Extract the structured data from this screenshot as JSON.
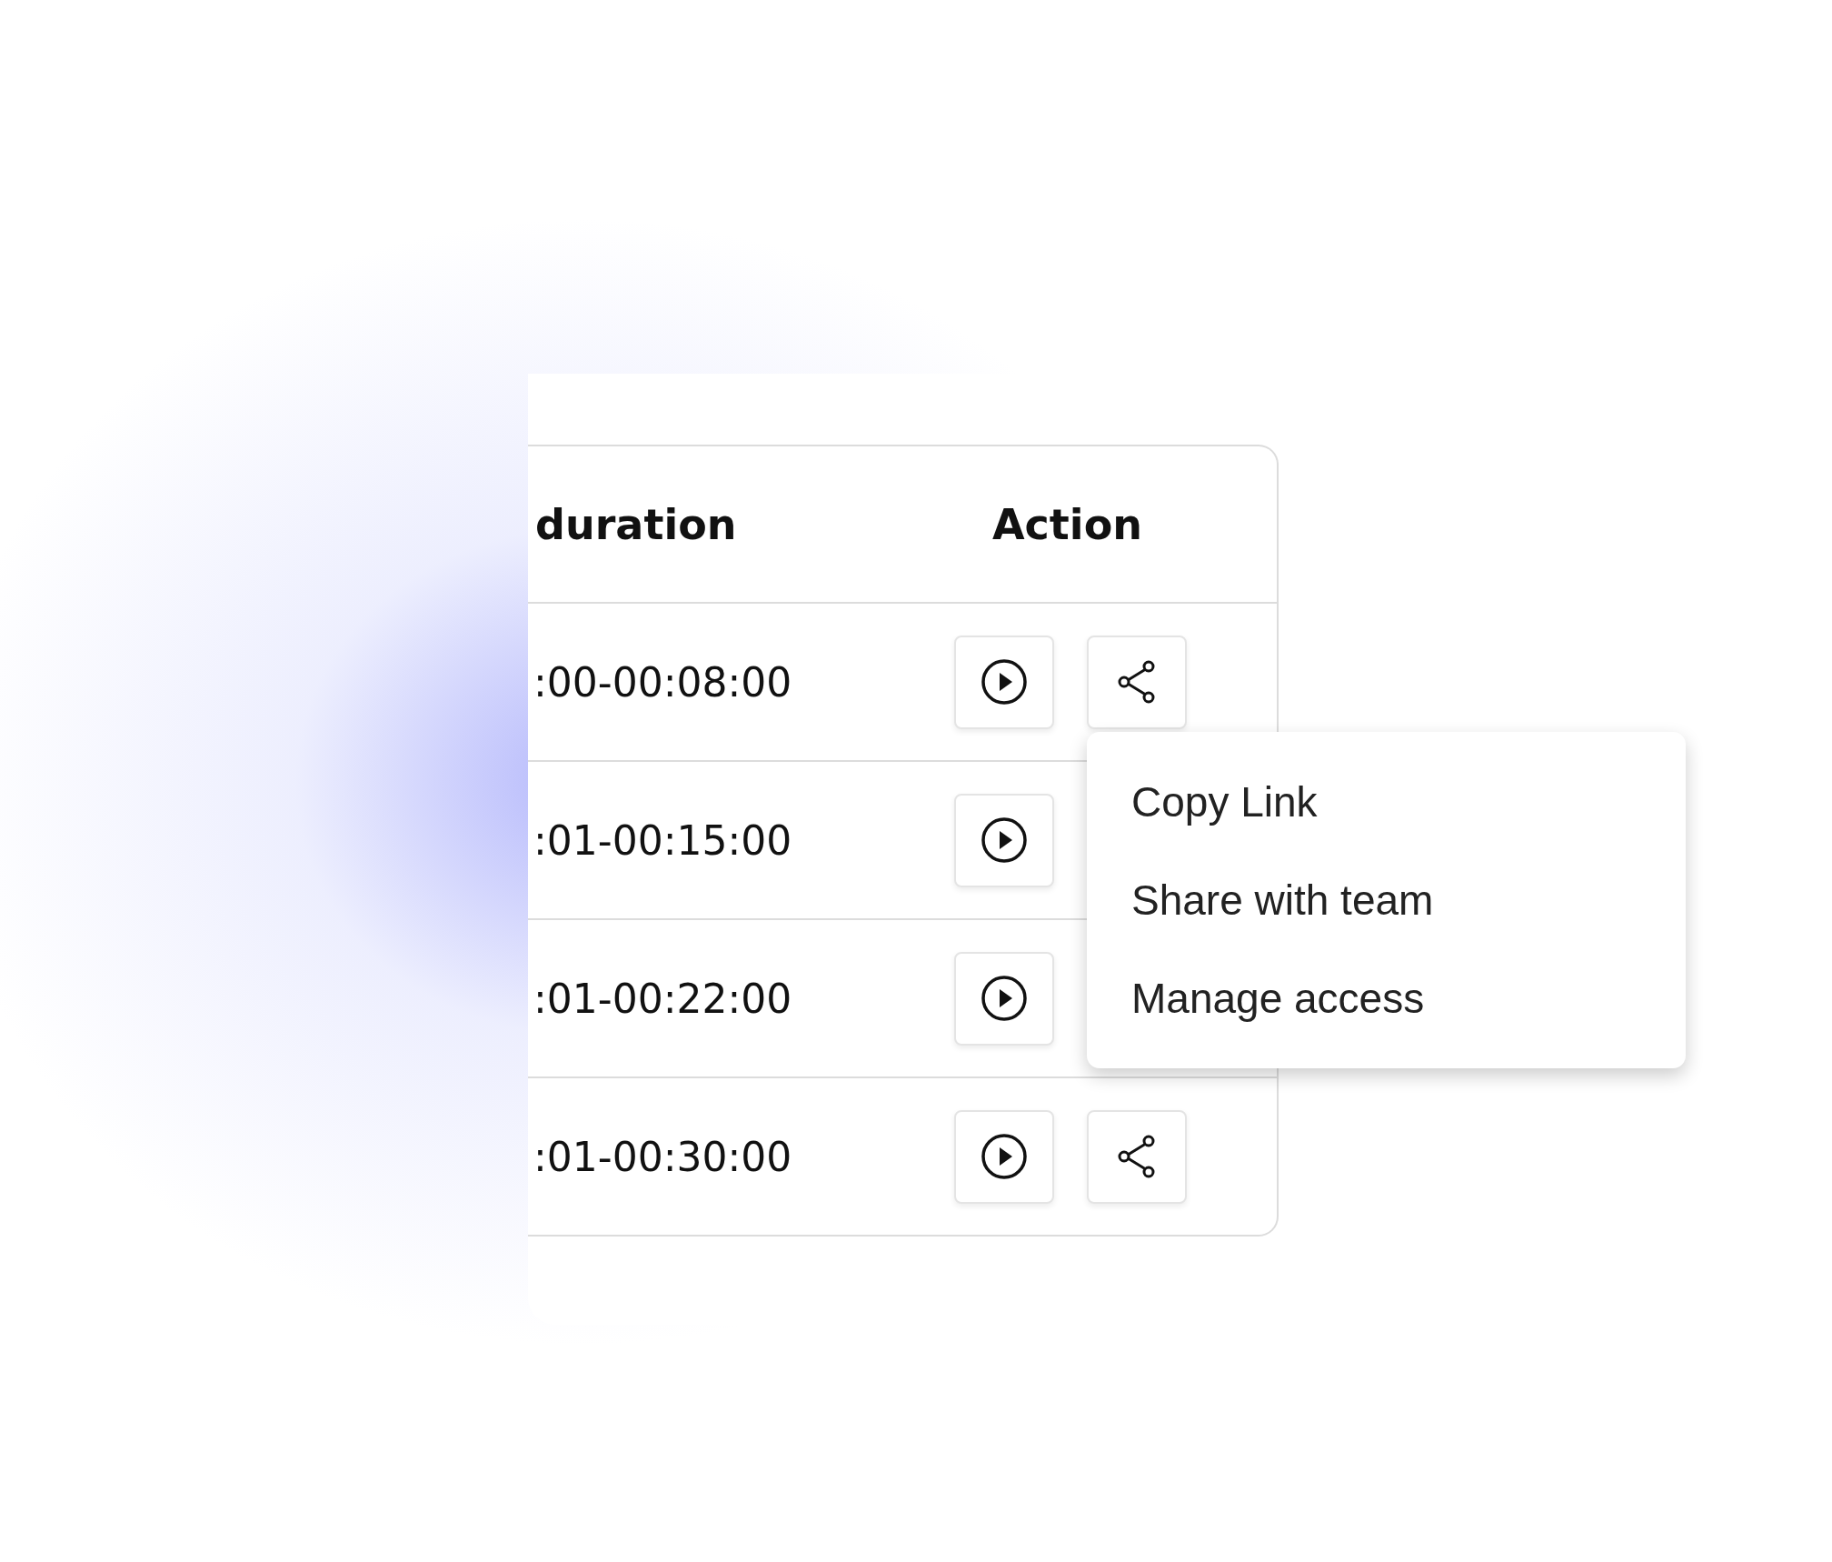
{
  "table": {
    "columns": [
      {
        "label": "duration"
      },
      {
        "label": "Action"
      }
    ],
    "rows": [
      {
        "duration": ":00-00:08:00",
        "actions": [
          {
            "kind": "play"
          },
          {
            "kind": "share"
          }
        ]
      },
      {
        "duration": ":01-00:15:00",
        "actions": [
          {
            "kind": "play"
          }
        ]
      },
      {
        "duration": ":01-00:22:00",
        "actions": [
          {
            "kind": "play"
          }
        ]
      },
      {
        "duration": ":01-00:30:00",
        "actions": [
          {
            "kind": "play"
          },
          {
            "kind": "share"
          }
        ]
      }
    ]
  },
  "menu": {
    "items": [
      "Copy Link",
      "Share with team",
      "Manage access"
    ]
  }
}
